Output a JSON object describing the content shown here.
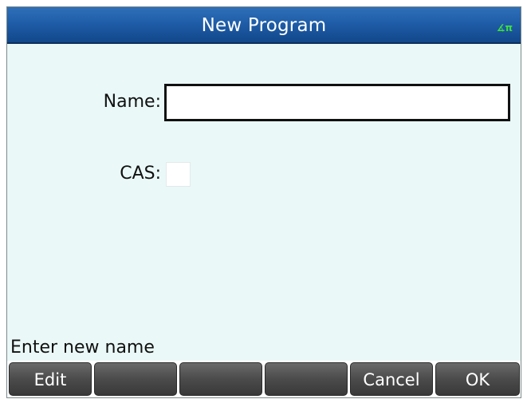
{
  "window": {
    "title": "New Program",
    "angle_indicator": "∡π",
    "angle_indicator_color": "#3de23d"
  },
  "form": {
    "name_label": "Name:",
    "name_value": "",
    "cas_label": "CAS:",
    "cas_checked": false
  },
  "status": {
    "message": "Enter new name"
  },
  "softkeys": [
    {
      "label": "Edit"
    },
    {
      "label": ""
    },
    {
      "label": ""
    },
    {
      "label": ""
    },
    {
      "label": "Cancel"
    },
    {
      "label": "OK"
    }
  ],
  "colors": {
    "title_bar": "#1f5da8",
    "background": "#eaf8f7",
    "softkey": "#4b4b4b"
  }
}
